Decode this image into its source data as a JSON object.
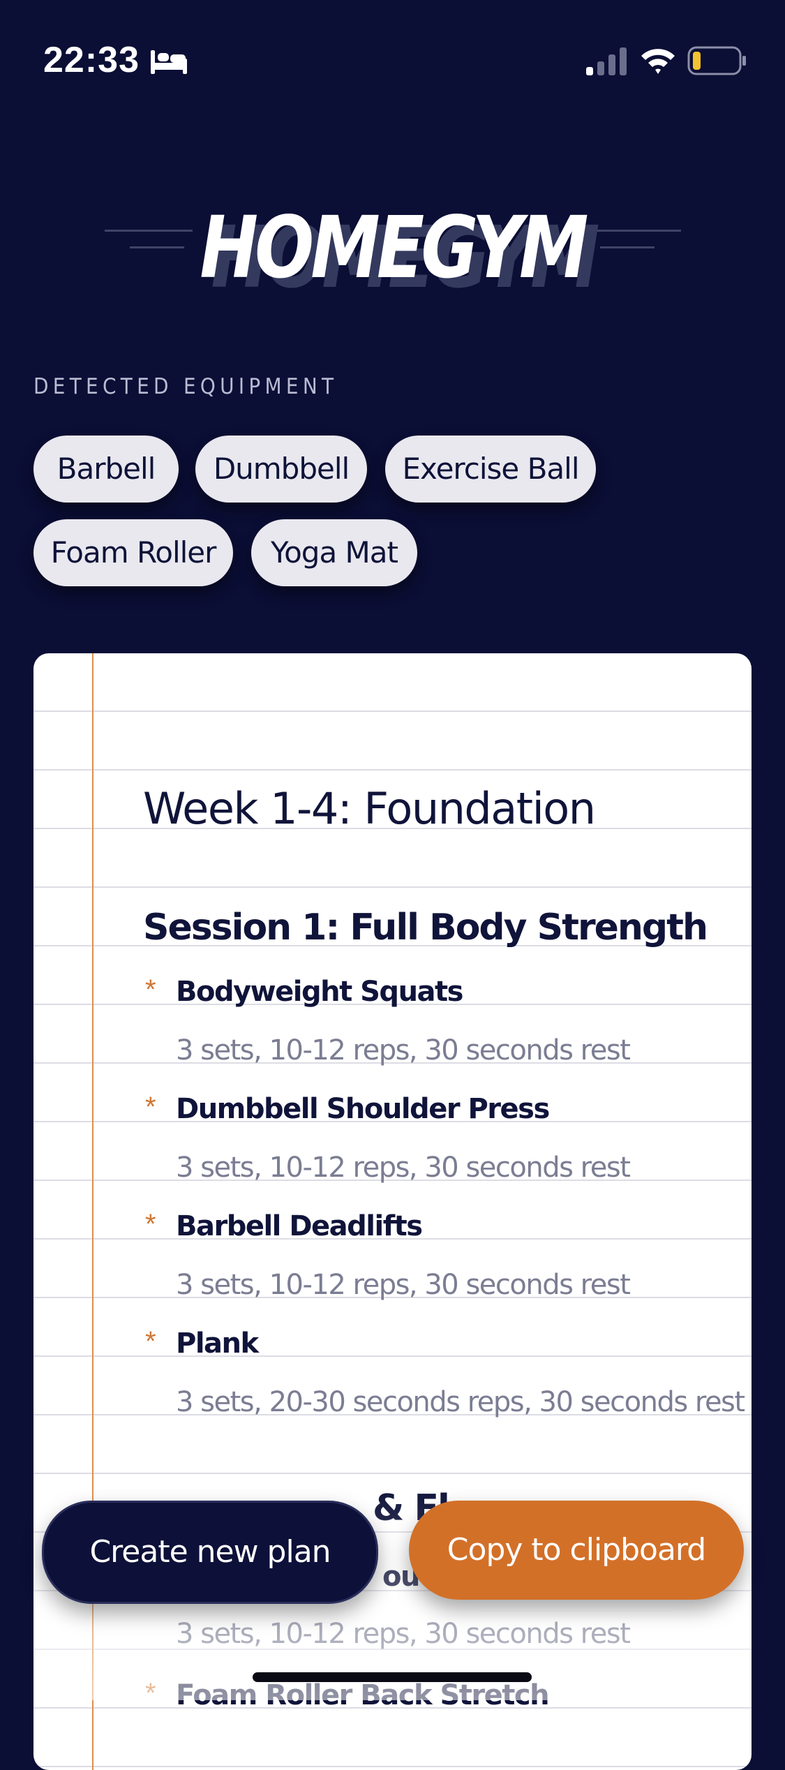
{
  "status_bar": {
    "time": "22:33",
    "icons": [
      "bed-icon",
      "cellular-signal-icon",
      "wifi-icon",
      "battery-icon"
    ]
  },
  "app": {
    "title": "HOMEGYM"
  },
  "equipment": {
    "label": "DETECTED EQUIPMENT",
    "items": [
      "Barbell",
      "Dumbbell",
      "Exercise Ball",
      "Foam Roller",
      "Yoga Mat"
    ]
  },
  "plan": {
    "week_title": "Week 1-4: Foundation",
    "sessions": [
      {
        "title": "Session 1: Full Body Strength",
        "exercises": [
          {
            "name": "Bodyweight Squats",
            "detail": "3 sets, 10-12 reps, 30 seconds rest"
          },
          {
            "name": "Dumbbell Shoulder Press",
            "detail": "3 sets, 10-12 reps, 30 seconds rest"
          },
          {
            "name": "Barbell Deadlifts",
            "detail": "3 sets, 10-12 reps, 30 seconds rest"
          },
          {
            "name": "Plank",
            "detail": "3 sets, 20-30 seconds reps, 30 seconds rest"
          }
        ]
      },
      {
        "title_fragment": "& Fl",
        "exercises": [
          {
            "name_fragment": "outs",
            "detail": "3 sets, 10-12 reps, 30 seconds rest"
          },
          {
            "name_fragment": "Foam Roller Back Stretch"
          }
        ]
      }
    ]
  },
  "actions": {
    "create_label": "Create new plan",
    "copy_label": "Copy to clipboard"
  },
  "colors": {
    "background": "#0b0e35",
    "accent_orange": "#d37028",
    "chip_background": "#e9e8ef",
    "text_dark": "#10143a"
  }
}
